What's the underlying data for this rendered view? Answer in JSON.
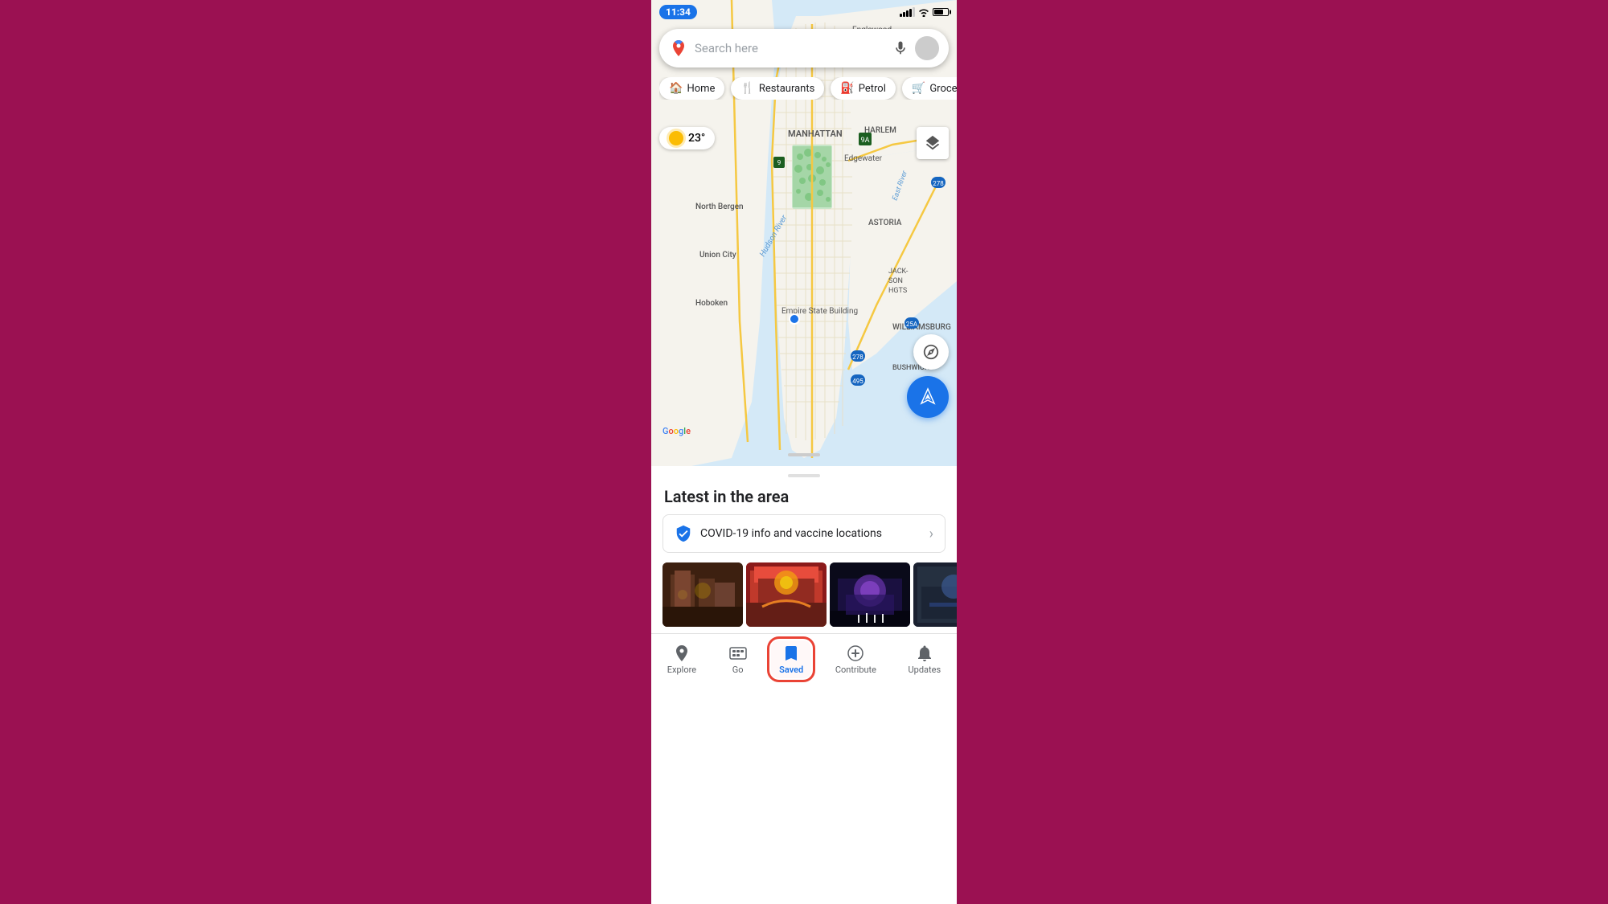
{
  "statusBar": {
    "time": "11:34"
  },
  "searchBar": {
    "placeholder": "Search here"
  },
  "categories": [
    {
      "id": "home",
      "label": "Home",
      "icon": "🏠"
    },
    {
      "id": "restaurants",
      "label": "Restaurants",
      "icon": "🍴"
    },
    {
      "id": "petrol",
      "label": "Petrol",
      "icon": "⛽"
    },
    {
      "id": "groceries",
      "label": "Groce...",
      "icon": "🛒"
    }
  ],
  "weather": {
    "temp": "23°"
  },
  "bottomSheet": {
    "title": "Latest in the area",
    "covidBanner": "COVID-19 info and vaccine locations"
  },
  "bottomNav": {
    "items": [
      {
        "id": "explore",
        "label": "Explore",
        "active": false
      },
      {
        "id": "go",
        "label": "Go",
        "active": false
      },
      {
        "id": "saved",
        "label": "Saved",
        "active": true
      },
      {
        "id": "contribute",
        "label": "Contribute",
        "active": false
      },
      {
        "id": "updates",
        "label": "Updates",
        "active": false
      }
    ]
  }
}
